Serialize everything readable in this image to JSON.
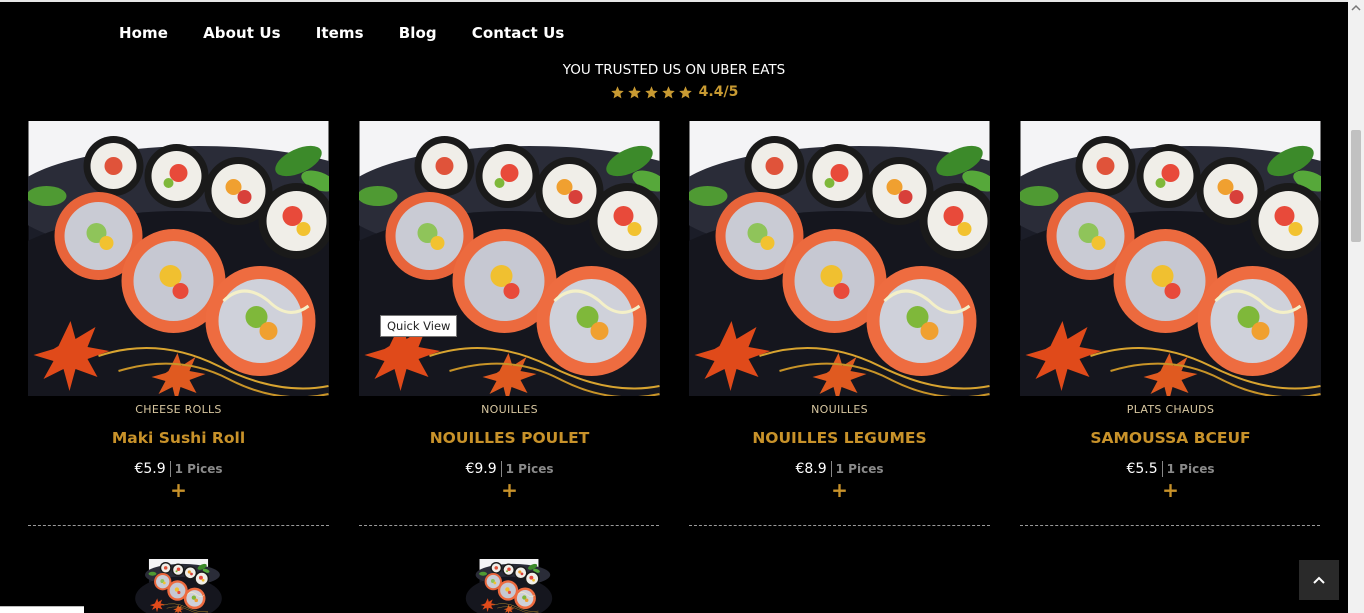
{
  "nav": {
    "items": [
      {
        "label": "Home"
      },
      {
        "label": "About Us"
      },
      {
        "label": "Items"
      },
      {
        "label": "Blog"
      },
      {
        "label": "Contact Us"
      }
    ]
  },
  "trust": {
    "title": "YOU TRUSTED US ON UBER EATS",
    "rating_text": "4.4/5",
    "rating_value": 4.4,
    "star_count": 5
  },
  "products": [
    {
      "category": "CHEESE ROLLS",
      "name": "Maki Sushi Roll",
      "price": "€5.9",
      "pieces": "1 Pices"
    },
    {
      "category": "NOUILLES",
      "name": "NOUILLES POULET",
      "price": "€9.9",
      "pieces": "1 Pices"
    },
    {
      "category": "NOUILLES",
      "name": "NOUILLES LEGUMES",
      "price": "€8.9",
      "pieces": "1 Pices"
    },
    {
      "category": "PLATS CHAUDS",
      "name": "SAMOUSSA BCEUF",
      "price": "€5.5",
      "pieces": "1 Pices"
    }
  ],
  "tooltip": {
    "label": "Quick View"
  },
  "colors": {
    "accent": "#c8922a",
    "background": "#000000",
    "star": "#c89a32"
  },
  "icons": {
    "plus": "plus-icon",
    "star": "star-icon",
    "back_to_top": "chevron-up-icon"
  }
}
